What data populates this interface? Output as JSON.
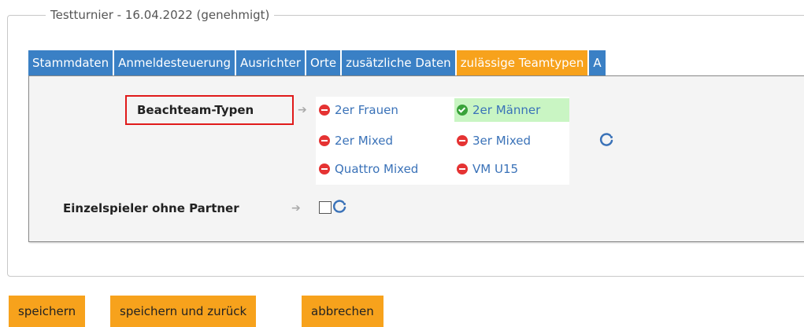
{
  "fieldset": {
    "legend": "Testturnier - 16.04.2022 (genehmigt)"
  },
  "tabs": [
    {
      "label": "Stammdaten"
    },
    {
      "label": "Anmeldesteuerung"
    },
    {
      "label": "Ausrichter"
    },
    {
      "label": "Orte"
    },
    {
      "label": "zusätzliche Daten"
    },
    {
      "label": "zulässige Teamtypen",
      "active": true
    },
    {
      "label": "A"
    }
  ],
  "beachteam": {
    "label": "Beachteam-Typen",
    "types": [
      {
        "label": "2er Frauen",
        "status": "excluded"
      },
      {
        "label": "2er Männer",
        "status": "allowed"
      },
      {
        "label": "2er Mixed",
        "status": "excluded"
      },
      {
        "label": "3er Mixed",
        "status": "excluded"
      },
      {
        "label": "Quattro Mixed",
        "status": "excluded"
      },
      {
        "label": "VM U15",
        "status": "excluded"
      }
    ],
    "refresh_icon": "refresh-icon"
  },
  "einzelspieler": {
    "label": "Einzelspieler ohne Partner",
    "checked": false,
    "refresh_icon": "refresh-icon"
  },
  "buttons": {
    "save": "speichern",
    "save_back": "speichern und zurück",
    "cancel": "abbrechen"
  },
  "colors": {
    "tab_blue": "#3a80c5",
    "tab_active": "#f7a21c",
    "button": "#f7a21c",
    "allowed_bg": "#c9f5c3",
    "excluded_icon": "#e53333",
    "allowed_icon": "#3aa33a",
    "highlight_border": "#e01a1a"
  }
}
